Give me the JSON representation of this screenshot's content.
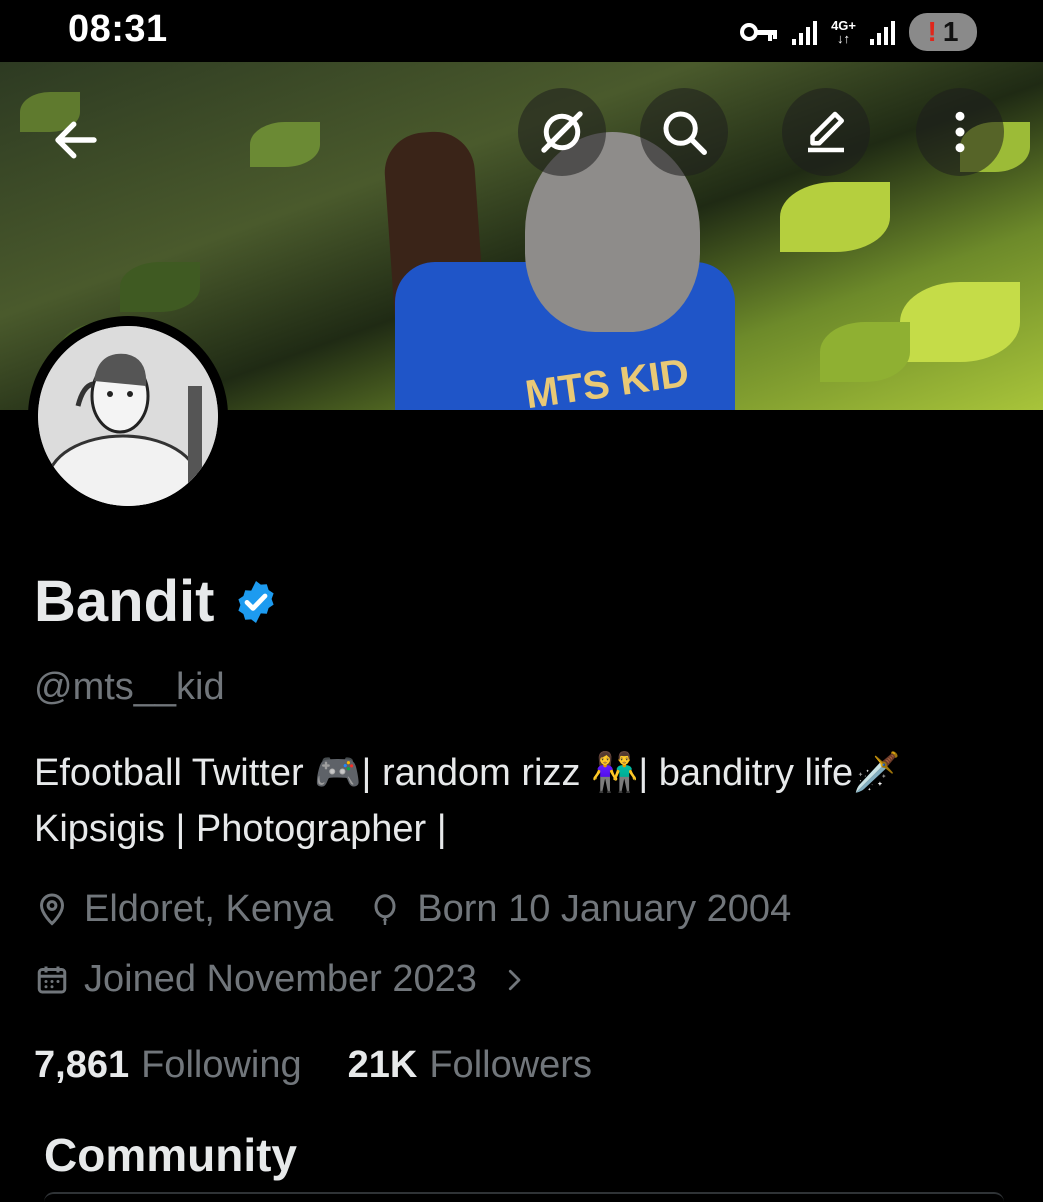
{
  "status_bar": {
    "time": "08:31",
    "network": "4G+",
    "notification_count": "1"
  },
  "header": {
    "back_icon": "arrow-left-icon",
    "grok_icon": "grok-icon",
    "search_icon": "search-icon",
    "edit_icon": "edit-pencil-icon",
    "more_icon": "more-vertical-icon"
  },
  "banner": {
    "shirt_text": "MTS KID"
  },
  "profile": {
    "name": "Bandit",
    "handle": "@mts__kid",
    "bio_line1": "Efootball Twitter 🎮| random rizz 👫| banditry life🗡️",
    "bio_line2": "Kipsigis | Photographer |",
    "location": "Eldoret, Kenya",
    "birthday": "Born 10 January 2004",
    "joined": "Joined November 2023",
    "following_count": "7,861",
    "following_label": "Following",
    "followers_count": "21K",
    "followers_label": "Followers"
  },
  "community": {
    "heading": "Community"
  },
  "colors": {
    "background": "#000000",
    "primary_text": "#e7e9ea",
    "secondary_text": "#71767b",
    "verified_blue": "#1d9bf0"
  }
}
